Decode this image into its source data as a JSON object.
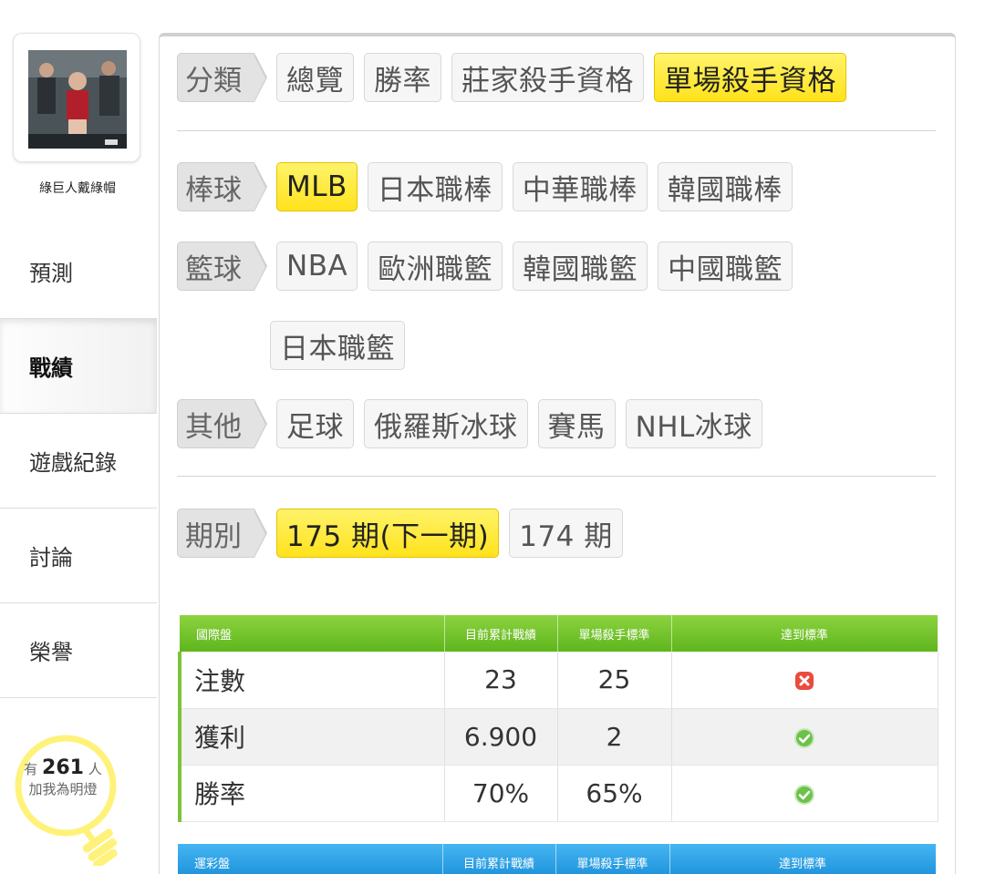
{
  "sidebar": {
    "username": "綠巨人戴綠帽",
    "nav": [
      {
        "label": "預測"
      },
      {
        "label": "戰績"
      },
      {
        "label": "遊戲紀錄"
      },
      {
        "label": "討論"
      },
      {
        "label": "榮譽"
      }
    ],
    "bulb": {
      "prefix": "有",
      "count": "261",
      "suffix": "人",
      "caption": "加我為明燈"
    }
  },
  "filters": {
    "category": {
      "label": "分類",
      "options": [
        "總覽",
        "勝率",
        "莊家殺手資格",
        "單場殺手資格"
      ],
      "selected": "單場殺手資格"
    },
    "baseball": {
      "label": "棒球",
      "options": [
        "MLB",
        "日本職棒",
        "中華職棒",
        "韓國職棒"
      ],
      "selected": "MLB"
    },
    "basketball": {
      "label": "籃球",
      "options": [
        "NBA",
        "歐洲職籃",
        "韓國職籃",
        "中國職籃",
        "日本職籃"
      ]
    },
    "other": {
      "label": "其他",
      "options": [
        "足球",
        "俄羅斯冰球",
        "賽馬",
        "NHL冰球"
      ]
    },
    "period": {
      "label": "期別",
      "options": [
        "175 期(下一期)",
        "174 期"
      ],
      "selected": "175 期(下一期)"
    }
  },
  "intl_table": {
    "headers": [
      "國際盤",
      "目前累計戰績",
      "單場殺手標準",
      "達到標準"
    ],
    "rows": [
      {
        "name": "注數",
        "current": "23",
        "standard": "25",
        "met": "fail"
      },
      {
        "name": "獲利",
        "current": "6.900",
        "standard": "2",
        "met": "pass"
      },
      {
        "name": "勝率",
        "current": "70%",
        "standard": "65%",
        "met": "pass"
      }
    ]
  },
  "sports_table": {
    "headers": [
      "運彩盤",
      "目前累計戰績",
      "單場殺手標準",
      "達到標準"
    ]
  },
  "colors": {
    "active_tag": "#ffe21c",
    "intl_header": "#6cbf26",
    "sports_header": "#2a9ee3",
    "pass": "#6cc24a",
    "fail": "#e84c3d"
  }
}
